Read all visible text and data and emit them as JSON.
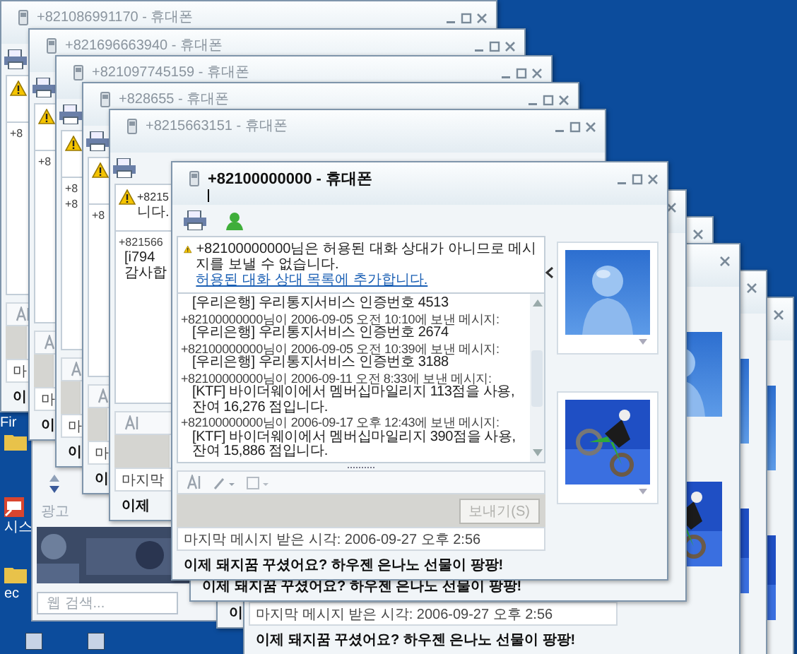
{
  "desktop": {
    "icons": [
      {
        "kind": "covered",
        "label": "Fir"
      },
      {
        "kind": "folder"
      },
      {
        "kind": "shortcut",
        "label": "시스"
      },
      {
        "kind": "folder",
        "label": "ec"
      },
      {
        "kind": "app"
      },
      {
        "kind": "app"
      }
    ]
  },
  "messenger": {
    "ad_label": "광고",
    "search": {
      "placeholder": "웹 검색..."
    }
  },
  "windows": [
    {
      "kind": "back_right"
    },
    {
      "kind": "back_right"
    },
    {
      "kind": "back_right",
      "ad": "이"
    },
    {
      "kind": "back_right",
      "status": "마지막 메시지 받은 시각: 2006-09-27 오후 2:56",
      "ad": "이제 돼지꿈 꾸셨어요? 하우젠 은나노 선물이 팡팡!"
    },
    {
      "kind": "back_right",
      "ad": "이제 돼지꿈 꾸셨어요? 하우젠 은나노 선물이 팡팡!"
    },
    {
      "kind": "back_left",
      "active": false,
      "title": "+821086991170 - 휴대폰",
      "warning": true,
      "log": [
        {
          "kind": "header",
          "text": "+8"
        }
      ],
      "status": "마",
      "ad": "이"
    },
    {
      "kind": "back_left",
      "active": false,
      "title": "+821696663940 - 휴대폰",
      "warning": true,
      "log": [
        {
          "kind": "header",
          "text": "+8"
        }
      ],
      "status": "마",
      "ad": "이"
    },
    {
      "kind": "back_left",
      "active": false,
      "title": "+821097745159 - 휴대폰",
      "warning": true,
      "log": [
        {
          "kind": "header",
          "text": "+8"
        },
        {
          "kind": "header",
          "text": "+8"
        }
      ],
      "status": "마",
      "ad": "이"
    },
    {
      "kind": "back_left",
      "active": false,
      "title": "+828655 - 휴대폰",
      "warning": true,
      "log": [
        {
          "kind": "header",
          "text": "+8"
        }
      ],
      "status": "마",
      "ad": "이"
    },
    {
      "kind": "back_left",
      "active": false,
      "title": "+8215663151 - 휴대폰",
      "warning": true,
      "notice_lines": [
        "+8215",
        "니다."
      ],
      "log": [
        {
          "kind": "header",
          "text": "+821566"
        },
        {
          "kind": "body",
          "text": "[i794"
        },
        {
          "kind": "body",
          "text": "감사합"
        }
      ],
      "status": "마지막",
      "ad": "이제"
    },
    {
      "kind": "front",
      "active": true,
      "title": "+82100000000 - 휴대폰",
      "warning": true,
      "notice": "+82100000000님은 허용된 대화 상대가 아니므로 메시지를 보낼 수 없습니다.",
      "notice_link": "허용된 대화 상대 목록에 추가합니다.",
      "log": [
        {
          "kind": "body",
          "text": "[우리은행] 우리통지서비스 인증번호 4513"
        },
        {
          "kind": "header",
          "text": "+82100000000님이 2006-09-05 오전 10:10에 보낸 메시지:"
        },
        {
          "kind": "body",
          "text": "[우리은행] 우리통지서비스 인증번호 2674"
        },
        {
          "kind": "header",
          "text": "+82100000000님이 2006-09-05 오전 10:39에 보낸 메시지:"
        },
        {
          "kind": "body",
          "text": "[우리은행] 우리통지서비스 인증번호 3188"
        },
        {
          "kind": "header",
          "text": "+82100000000님이 2006-09-11 오전 8:33에 보낸 메시지:"
        },
        {
          "kind": "body",
          "text": "[KTF] 바이더웨이에서 멤버십마일리지 113점을 사용, 잔여 16,276 점입니다."
        },
        {
          "kind": "header",
          "text": "+82100000000님이 2006-09-17 오후 12:43에 보낸 메시지:"
        },
        {
          "kind": "body",
          "text": "[KTF] 바이더웨이에서 멤버십마일리지 390점을 사용, 잔여 15,886 점입니다."
        }
      ],
      "send_button": {
        "label": "보내기(S)",
        "disabled": true
      },
      "status": "마지막 메시지 받은 시각: 2006-09-27 오후 2:56",
      "ad": "이제 돼지꿈 꾸셨어요? 하우젠 은나노 선물이 팡팡!"
    }
  ]
}
